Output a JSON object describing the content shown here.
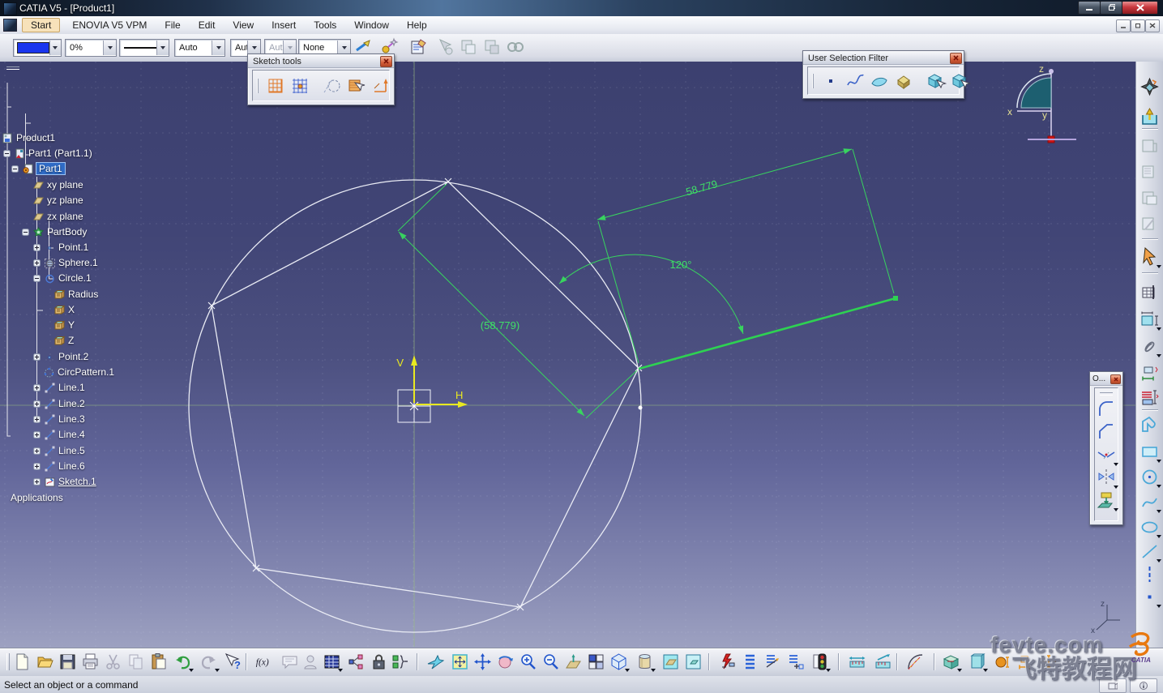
{
  "titlebar": {
    "title": "CATIA V5 - [Product1]"
  },
  "menubar": {
    "items": [
      "Start",
      "ENOVIA V5 VPM",
      "File",
      "Edit",
      "View",
      "Insert",
      "Tools",
      "Window",
      "Help"
    ]
  },
  "graphic_toolbar": {
    "fill_color": "#1a35ee",
    "opacity": "0%",
    "line_weight": "Auto",
    "line_type_b": "Aut",
    "line_type_c": "Aut",
    "layer": "None",
    "icons": [
      "painter-brush",
      "wizard-wand",
      "graphic-properties",
      "whats-this-disabled",
      "copy-format-disabled",
      "paste-format-disabled",
      "format-options-disabled"
    ]
  },
  "palettes": {
    "sketch_tools": {
      "title": "Sketch tools",
      "icons": [
        "grid",
        "snap-to-point",
        "construction-standard-element",
        "geometrical-constraints",
        "dimensional-constraints"
      ]
    },
    "user_selection_filter": {
      "title": "User Selection Filter",
      "icons": [
        "point-filter",
        "curve-filter",
        "surface-filter",
        "volume-filter",
        "intersecting-trap",
        "inside-trap"
      ]
    },
    "operation": {
      "title": "O...",
      "icons": [
        "corner",
        "chamfer",
        "trim",
        "mirror",
        "project-3d-elements"
      ]
    }
  },
  "tree": {
    "items": [
      {
        "label": "Product1"
      },
      {
        "label": "Part1 (Part1.1)"
      },
      {
        "label": "Part1",
        "selected": true
      },
      {
        "label": "xy plane"
      },
      {
        "label": "yz plane"
      },
      {
        "label": "zx plane"
      },
      {
        "label": "PartBody"
      },
      {
        "label": "Point.1"
      },
      {
        "label": "Sphere.1"
      },
      {
        "label": "Circle.1"
      },
      {
        "label": "Radius"
      },
      {
        "label": "X"
      },
      {
        "label": "Y"
      },
      {
        "label": "Z"
      },
      {
        "label": "Point.2"
      },
      {
        "label": "CircPattern.1"
      },
      {
        "label": "Line.1"
      },
      {
        "label": "Line.2"
      },
      {
        "label": "Line.3"
      },
      {
        "label": "Line.4"
      },
      {
        "label": "Line.5"
      },
      {
        "label": "Line.6"
      },
      {
        "label": "Sketch.1",
        "underlined": true
      },
      {
        "label": "Applications"
      }
    ]
  },
  "sketch": {
    "dim_pattern_line": "58.779",
    "dim_reference": "(58.779)",
    "dim_angle": "120°",
    "axis_v_label": "V",
    "axis_h_label": "H",
    "colors": {
      "geometry_white": "#eceef6",
      "selected_green": "#2ed152",
      "dimension_green": "#3fe067",
      "axis_yellow": "#e9e920"
    }
  },
  "compass": {
    "x_label": "x",
    "y_label": "y",
    "z_label": "z"
  },
  "corner_axis": {
    "x_label": "x",
    "z_label": "z"
  },
  "right_toolbar": {
    "icons": [
      "sketcher-workbench",
      "exit-workbench",
      "disabled-tool-1",
      "disabled-tool-2",
      "disabled-tool-3",
      "disabled-tool-4",
      "select",
      "sketch-analysis-table",
      "constraints-dialog-box",
      "fix-together",
      "auto-constraint",
      "animate-constraint",
      "profile",
      "rectangle",
      "circle",
      "spline",
      "ellipse",
      "line",
      "axis",
      "point"
    ]
  },
  "bottom_toolbar": {
    "icons": [
      "new",
      "open",
      "save",
      "print",
      "cut",
      "copy",
      "paste",
      "undo",
      "redo",
      "whats-this",
      "formula",
      "comments",
      "people",
      "design-table",
      "relations",
      "lock",
      "parameters",
      "fly-mode",
      "fit-all-in",
      "pan",
      "rotate",
      "zoom-in",
      "zoom-out",
      "normal-view",
      "multi-view",
      "isometric-view",
      "render-style",
      "hide-show",
      "swap-visible-space",
      "update",
      "scan-list",
      "list-edit",
      "list-insert",
      "traffic-status",
      "measure-between",
      "measure-item",
      "curvature-analysis",
      "volume-tool-1",
      "volume-tool-2",
      "hidden-orange-1",
      "hidden-orange-2",
      "hidden-orange-3"
    ]
  },
  "glyphs": {
    "formula": "f(x)",
    "help": "?"
  },
  "statusbar": {
    "message": "Select an object or a command"
  },
  "watermark": {
    "site": "fevte.com",
    "site_cn": "飞特教程网",
    "logo": "CATIA"
  }
}
